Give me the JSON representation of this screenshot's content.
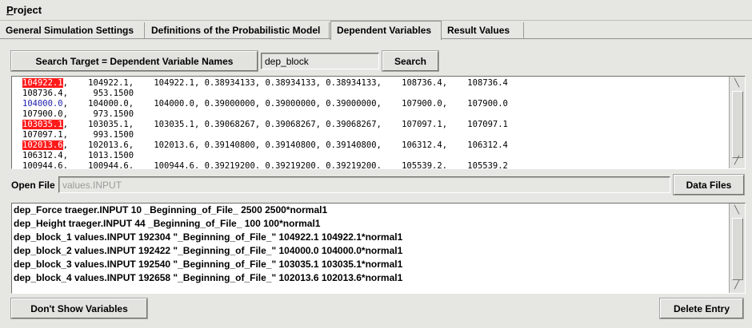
{
  "menu": {
    "project": "Project"
  },
  "tabs": [
    {
      "label": "General Simulation Settings"
    },
    {
      "label": "Definitions of the Probabilistic Model"
    },
    {
      "label": "Dependent Variables"
    },
    {
      "label": "Result Values"
    }
  ],
  "search": {
    "target_button": "Search Target = Dependent Variable Names",
    "query": "dep_block",
    "button": "Search"
  },
  "results": {
    "lines": [
      {
        "first": "104922.1",
        "rest": ",    104922.1,    104922.1, 0.38934133, 0.38934133, 0.38934133,    108736.4,    108736.4",
        "style": "highlight"
      },
      {
        "first": "",
        "rest": "108736.4,     953.1500",
        "style": "plain"
      },
      {
        "first": "104000.0",
        "rest": ",    104000.0,    104000.0, 0.39000000, 0.39000000, 0.39000000,    107900.0,    107900.0",
        "style": "blue"
      },
      {
        "first": "",
        "rest": "107900.0,     973.1500",
        "style": "plain"
      },
      {
        "first": "103035.1",
        "rest": ",    103035.1,    103035.1, 0.39068267, 0.39068267, 0.39068267,    107097.1,    107097.1",
        "style": "highlight"
      },
      {
        "first": "",
        "rest": "107097.1,     993.1500",
        "style": "plain"
      },
      {
        "first": "102013.6",
        "rest": ",    102013.6,    102013.6, 0.39140800, 0.39140800, 0.39140800,    106312.4,    106312.4",
        "style": "highlight"
      },
      {
        "first": "",
        "rest": "106312.4,    1013.1500",
        "style": "plain"
      },
      {
        "first": "",
        "rest": "100944.6,    100944.6,    100944.6, 0.39219200, 0.39219200, 0.39219200,    105539.2,    105539.2",
        "style": "plain"
      }
    ]
  },
  "open_file": {
    "label": "Open File",
    "value": "values.INPUT",
    "data_files_button": "Data Files"
  },
  "variables": [
    "dep_Force traeger.INPUT 10 _Beginning_of_File_ 2500 2500*normal1",
    "dep_Height traeger.INPUT 44 _Beginning_of_File_ 100 100*normal1",
    "dep_block_1 values.INPUT 192304 \"_Beginning_of_File_\" 104922.1 104922.1*normal1",
    "dep_block_2 values.INPUT 192422 \"_Beginning_of_File_\" 104000.0 104000.0*normal1",
    "dep_block_3 values.INPUT 192540 \"_Beginning_of_File_\" 103035.1 103035.1*normal1",
    "dep_block_4 values.INPUT 192658 \"_Beginning_of_File_\" 102013.6 102013.6*normal1"
  ],
  "footer": {
    "dont_show_button": "Don't Show Variables",
    "delete_entry_button": "Delete Entry"
  },
  "icons": {
    "scroll_up": "scroll-up-arrow-icon",
    "scroll_down": "scroll-down-arrow-icon"
  },
  "colors": {
    "highlight": "#ff1a1a",
    "link_blue": "#1f1fb0"
  }
}
